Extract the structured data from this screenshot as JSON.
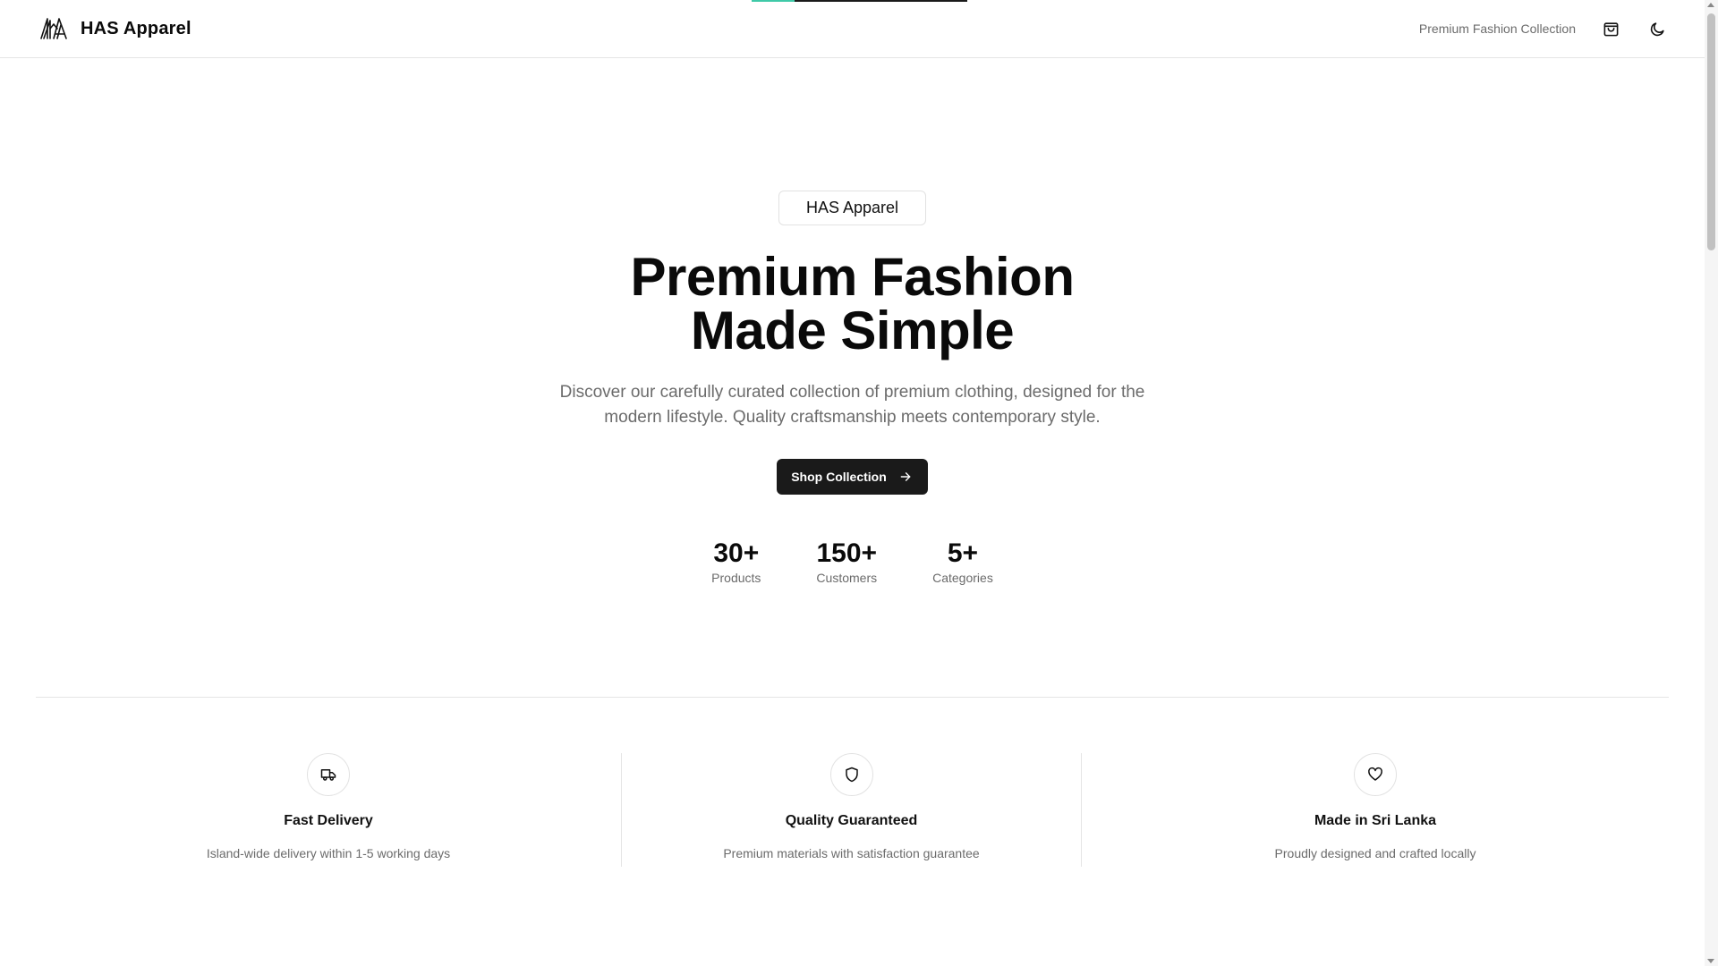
{
  "header": {
    "brand_name": "HAS Apparel",
    "tagline": "Premium Fashion Collection",
    "icons": [
      "brand-logo-icon",
      "shopping-bag-icon",
      "moon-icon"
    ]
  },
  "page_load_progress": 0.2,
  "hero": {
    "badge": "HAS Apparel",
    "title_line1": "Premium Fashion",
    "title_line2": "Made Simple",
    "subtitle": "Discover our carefully curated collection of premium clothing, designed for the modern lifestyle. Quality craftsmanship meets contemporary style.",
    "cta_label": "Shop Collection",
    "cta_icon": "arrow-right-icon"
  },
  "stats": [
    {
      "value": "30+",
      "label": "Products"
    },
    {
      "value": "150+",
      "label": "Customers"
    },
    {
      "value": "5+",
      "label": "Categories"
    }
  ],
  "features": [
    {
      "icon": "truck-icon",
      "title": "Fast Delivery",
      "desc": "Island-wide delivery within 1-5 working days"
    },
    {
      "icon": "shield-icon",
      "title": "Quality Guaranteed",
      "desc": "Premium materials with satisfaction guarantee"
    },
    {
      "icon": "heart-icon",
      "title": "Made in Sri Lanka",
      "desc": "Proudly designed and crafted locally"
    }
  ],
  "colors": {
    "accent": "#3fc9a8",
    "primary_button": "#1a1a1a",
    "muted_text": "#6b6b6b"
  }
}
